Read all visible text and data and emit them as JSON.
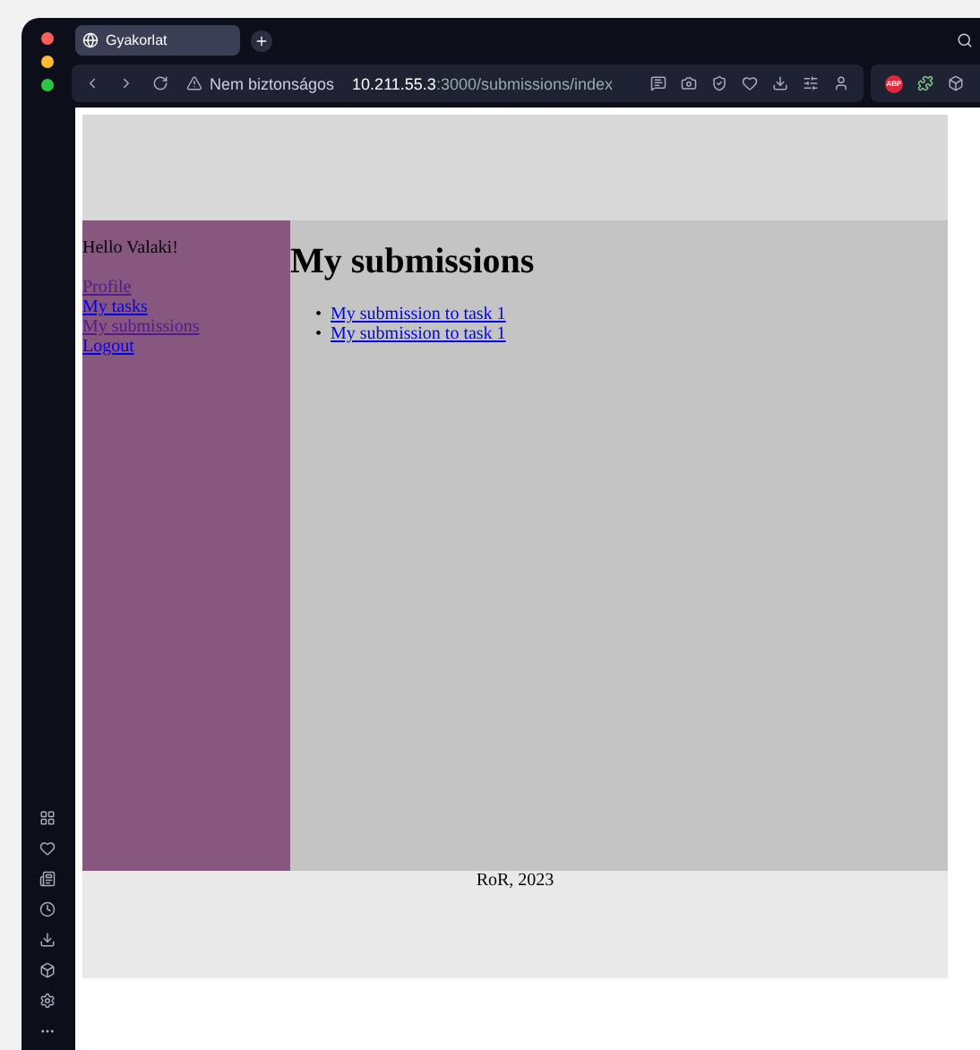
{
  "browser": {
    "tab": {
      "title": "Gyakorlat",
      "selected": true
    },
    "address": {
      "warning": "Nem biztonságos",
      "host": "10.211.55.3",
      "path": ":3000/submissions/index"
    },
    "extensions": [
      {
        "label": "ABP"
      }
    ]
  },
  "sidebar": {
    "greeting": "Hello Valaki!",
    "links": [
      {
        "label": "Profile",
        "visited": true
      },
      {
        "label": "My tasks",
        "visited": false
      },
      {
        "label": "My submissions",
        "visited": true
      },
      {
        "label": "Logout",
        "visited": false
      }
    ]
  },
  "main": {
    "title": "My submissions",
    "items": [
      {
        "marker": "•",
        "label": "My submission to task 1",
        "visited": false
      },
      {
        "marker": "•",
        "label": "My submission to task 1",
        "visited": false
      }
    ]
  },
  "footer": {
    "text": "RoR, 2023"
  }
}
